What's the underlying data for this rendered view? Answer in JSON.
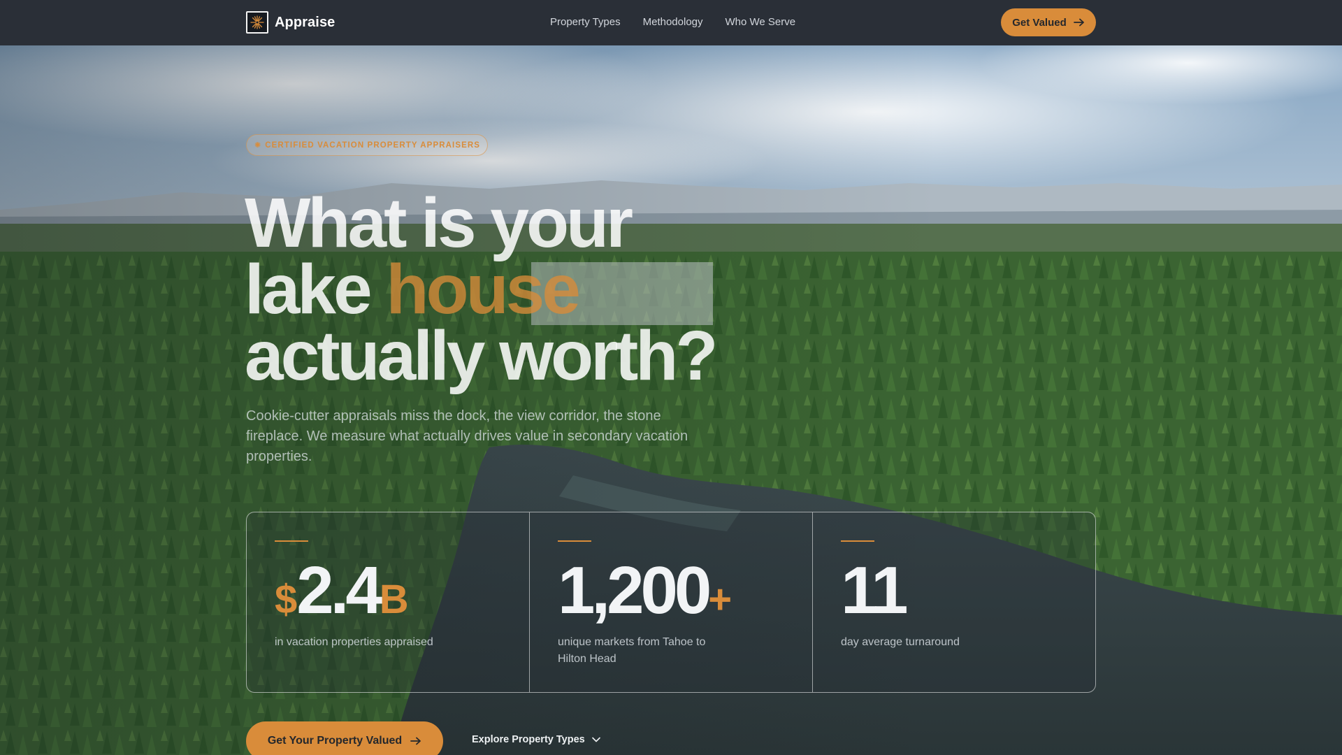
{
  "nav": {
    "brand": "Appraise",
    "links": [
      "Property Types",
      "Methodology",
      "Who We Serve"
    ],
    "cta": "Get Valued"
  },
  "hero": {
    "badge": "CERTIFIED VACATION PROPERTY APPRAISERS",
    "headline": {
      "line1": "What is your",
      "line2_start": "lake ",
      "line2_accent": "house",
      "line3": "actually worth?"
    },
    "subcopy": "Cookie-cutter appraisals miss the dock, the view corridor, the stone fireplace. We measure what actually drives value in secondary vacation properties."
  },
  "stats": [
    {
      "prefix": "$",
      "value": "2.4",
      "suffix": "B",
      "label": "in vacation properties appraised"
    },
    {
      "prefix": "",
      "value": "1,200",
      "suffix": "+",
      "label": "unique markets from Tahoe to Hilton Head"
    },
    {
      "prefix": "",
      "value": "11",
      "suffix": "",
      "label": "day average turnaround"
    }
  ],
  "cta": {
    "primary": "Get Your Property Valued",
    "secondary": "Explore Property Types"
  },
  "colors": {
    "accent": "#d98c3a",
    "nav_bg": "#2a2f37"
  },
  "icons": {
    "brand": "sunburst-icon",
    "arrow": "arrow-right-icon",
    "chevron": "chevron-down-icon",
    "badge": "sun-dot-icon"
  }
}
